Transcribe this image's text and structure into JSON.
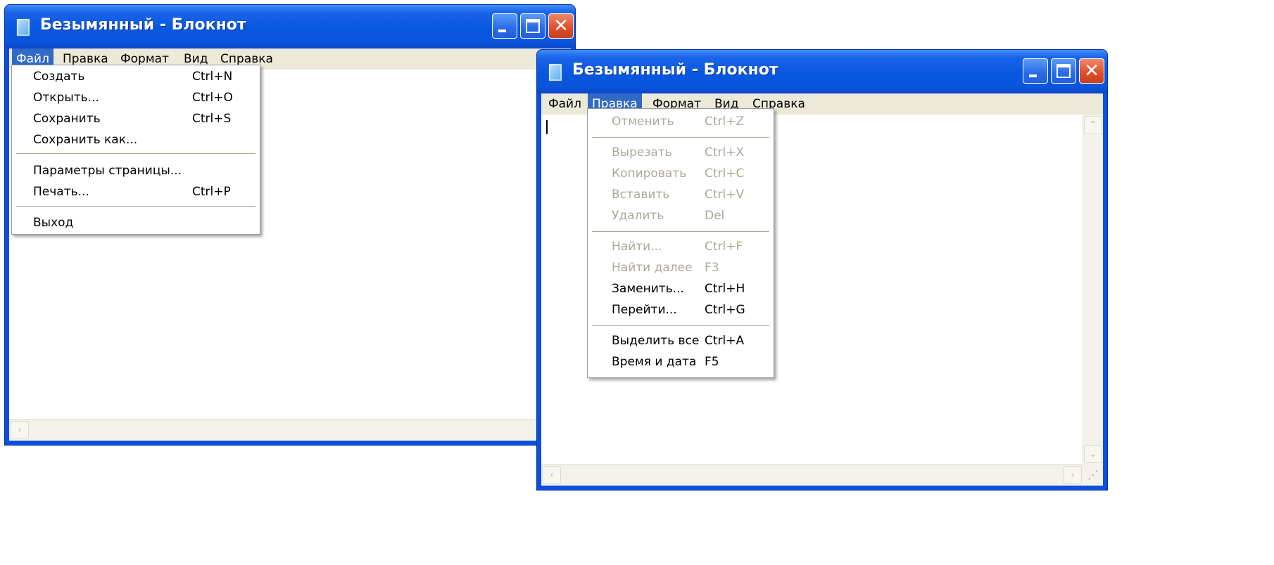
{
  "windows": [
    {
      "title": "Безымянный - Блокнот",
      "menu": [
        "Файл",
        "Правка",
        "Формат",
        "Вид",
        "Справка"
      ],
      "active_menu": "Файл",
      "dropdown": [
        {
          "label": "Создать",
          "shortcut": "Ctrl+N",
          "enabled": true
        },
        {
          "label": "Открыть...",
          "shortcut": "Ctrl+O",
          "enabled": true
        },
        {
          "label": "Сохранить",
          "shortcut": "Ctrl+S",
          "enabled": true
        },
        {
          "label": "Сохранить как...",
          "shortcut": "",
          "enabled": true
        },
        {
          "label": "Параметры страницы...",
          "shortcut": "",
          "enabled": true
        },
        {
          "label": "Печать...",
          "shortcut": "Ctrl+P",
          "enabled": true
        },
        {
          "label": "Выход",
          "shortcut": "",
          "enabled": true
        }
      ]
    },
    {
      "title": "Безымянный - Блокнот",
      "menu": [
        "Файл",
        "Правка",
        "Формат",
        "Вид",
        "Справка"
      ],
      "active_menu": "Правка",
      "dropdown": [
        {
          "label": "Отменить",
          "shortcut": "Ctrl+Z",
          "enabled": false
        },
        {
          "label": "Вырезать",
          "shortcut": "Ctrl+X",
          "enabled": false
        },
        {
          "label": "Копировать",
          "shortcut": "Ctrl+C",
          "enabled": false
        },
        {
          "label": "Вставить",
          "shortcut": "Ctrl+V",
          "enabled": false
        },
        {
          "label": "Удалить",
          "shortcut": "Del",
          "enabled": false
        },
        {
          "label": "Найти...",
          "shortcut": "Ctrl+F",
          "enabled": false
        },
        {
          "label": "Найти далее",
          "shortcut": "F3",
          "enabled": false
        },
        {
          "label": "Заменить...",
          "shortcut": "Ctrl+H",
          "enabled": true
        },
        {
          "label": "Перейти...",
          "shortcut": "Ctrl+G",
          "enabled": true
        },
        {
          "label": "Выделить все",
          "shortcut": "Ctrl+A",
          "enabled": true
        },
        {
          "label": "Время и дата",
          "shortcut": "F5",
          "enabled": true
        }
      ]
    }
  ],
  "colors": {
    "titlebar": "#0a55dc",
    "menu_highlight": "#316ac5",
    "menubar": "#ece9d8",
    "disabled_text": "#aca899"
  }
}
